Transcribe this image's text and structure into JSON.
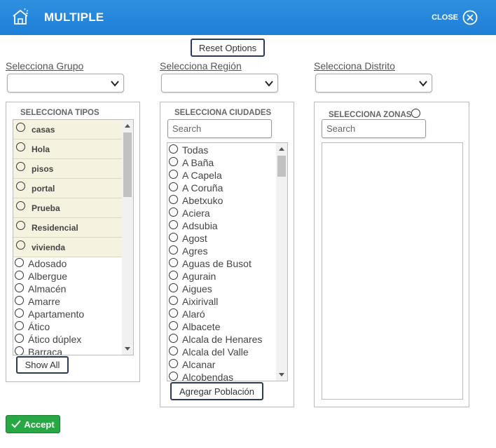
{
  "header": {
    "title": "MULTIPLE",
    "close_label": "CLOSE",
    "logo_icon": "house-icon",
    "close_icon": "close-circle-icon",
    "bg_color": "#1f7fd6"
  },
  "reset_label": "Reset Options",
  "selects": {
    "grupo_label": "Selecciona Grupo",
    "region_label": "Selecciona Región",
    "distrito_label": "Selecciona Distrito"
  },
  "tipos": {
    "title": "SELECCIONA TIPOS",
    "highlighted": [
      "casas",
      "Hola",
      "pisos",
      "portal",
      "Prueba",
      "Residencial",
      "vivienda"
    ],
    "items": [
      "Adosado",
      "Albergue",
      "Almacén",
      "Amarre",
      "Apartamento",
      "Ático",
      "Ático dúplex",
      "Barraca"
    ],
    "show_all_label": "Show All"
  },
  "ciudades": {
    "title": "SELECCIONA CIUDADES",
    "search_placeholder": "Search",
    "items": [
      "Todas",
      "A Baña",
      "A Capela",
      "A Coruña",
      "Abetxuko",
      "Aciera",
      "Adsubia",
      "Agost",
      "Agres",
      "Aguas de Busot",
      "Agurain",
      "Aigues",
      "Aixirivall",
      "Alaró",
      "Albacete",
      "Alcala de Henares",
      "Alcala del Valle",
      "Alcanar",
      "Alcobendas"
    ],
    "add_label": "Agregar Población"
  },
  "zonas": {
    "title": "SELECCIONA ZONAS",
    "search_placeholder": "Search"
  },
  "accept_label": "Accept",
  "accept_color": "#28a745"
}
